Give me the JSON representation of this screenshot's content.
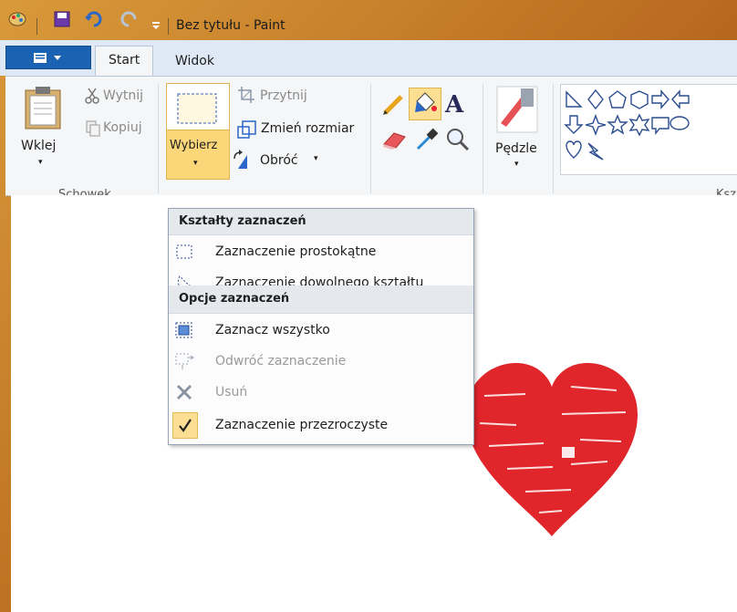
{
  "window": {
    "title": "Bez tytułu - Paint"
  },
  "tabs": [
    {
      "label": "Start"
    },
    {
      "label": "Widok"
    }
  ],
  "ribbon": {
    "clipboard": {
      "paste": "Wklej",
      "cut": "Wytnij",
      "copy": "Kopiuj",
      "group": "Schowek"
    },
    "image": {
      "select": "Wybierz",
      "crop": "Przytnij",
      "resize": "Zmień rozmiar",
      "rotate": "Obróć"
    },
    "brushes": {
      "label": "Pędzle"
    },
    "shapes": {
      "group": "Ksz"
    }
  },
  "menu": {
    "section1": "Kształty zaznaczeń",
    "rect_select": "Zaznaczenie prostokątne",
    "free_select": "Zaznaczenie dowolnego kształtu",
    "section2": "Opcje zaznaczeń",
    "select_all": "Zaznacz wszystko",
    "invert": "Odwróć zaznaczenie",
    "delete": "Usuń",
    "transparent": "Zaznaczenie przezroczyste"
  },
  "colors": {
    "accent": "#1b62b3",
    "highlight": "#fbd77a",
    "heart": "#e0252b"
  },
  "icons": [
    "paint-app-icon",
    "save-icon",
    "undo-icon",
    "redo-icon",
    "customize-icon",
    "clipboard-icon",
    "scissors-icon",
    "copy-icon",
    "select-icon",
    "crop-icon",
    "resize-icon",
    "rotate-icon",
    "pencil-icon",
    "fill-icon",
    "text-icon",
    "eraser-icon",
    "color-picker-icon",
    "magnifier-icon",
    "brush-icon",
    "checkmark-icon",
    "delete-icon"
  ]
}
